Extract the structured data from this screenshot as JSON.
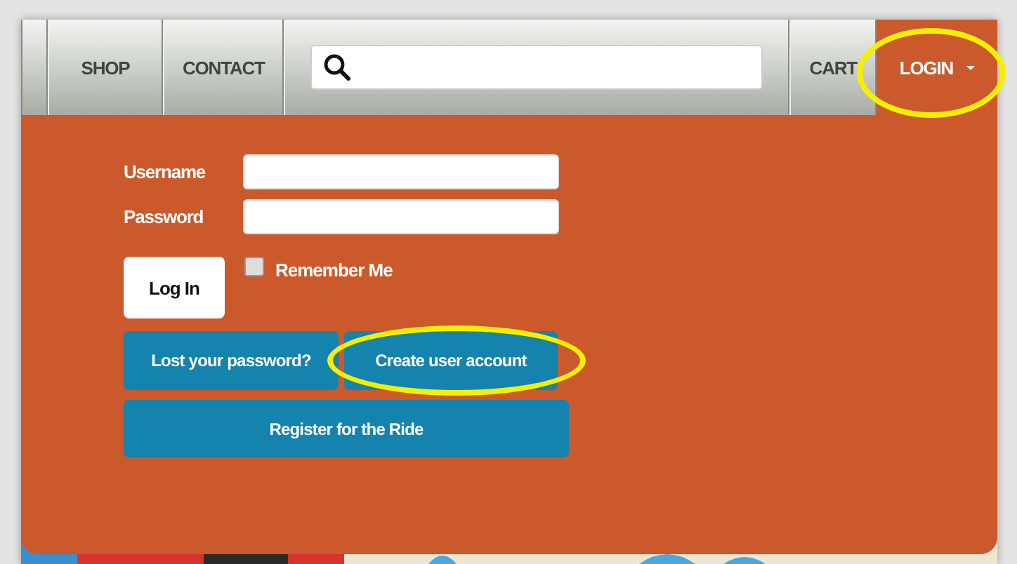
{
  "nav": [
    {
      "label": "SHOP",
      "kind": "link",
      "selected": false
    },
    {
      "label": "CONTACT",
      "kind": "link",
      "selected": false
    },
    {
      "kind": "search"
    },
    {
      "label": "CART",
      "kind": "link",
      "selected": false
    },
    {
      "label": "LOGIN",
      "kind": "dropdown",
      "selected": true
    }
  ],
  "login_form": {
    "fields": [
      {
        "label": "Username"
      },
      {
        "label": "Password"
      }
    ],
    "submit": "Log In",
    "remember": {
      "label": "Remember Me",
      "checked": false
    },
    "buttons": [
      {
        "label": "Lost your password?",
        "highlighted": false
      },
      {
        "label": "Create user account",
        "highlighted": true
      }
    ],
    "register": "Register for the Ride"
  }
}
